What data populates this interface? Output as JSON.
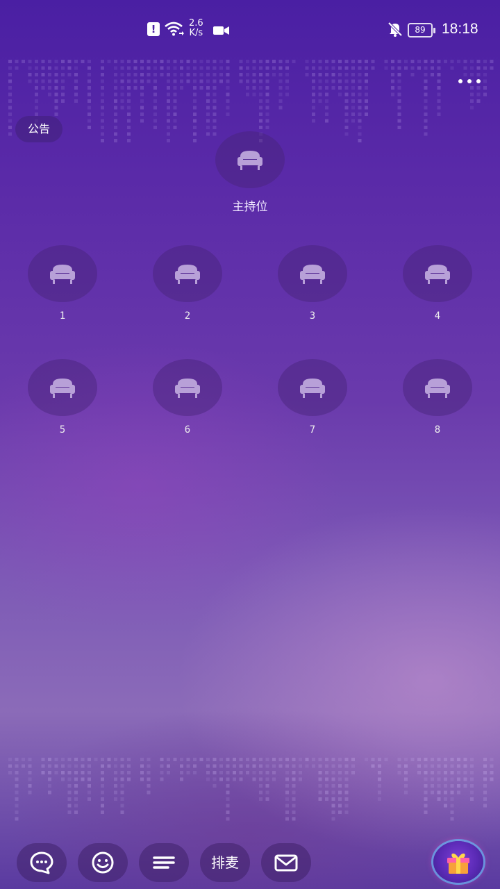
{
  "status_bar": {
    "network_speed_value": "2.6",
    "network_speed_unit": "K/s",
    "battery": "89",
    "time": "18:18",
    "icons": [
      "alert-icon",
      "wifi-icon",
      "video-icon",
      "bell-off-icon",
      "battery-icon"
    ]
  },
  "header": {
    "notice_label": "公告",
    "more_icon": "more-dots-icon"
  },
  "host_seat": {
    "label": "主持位",
    "icon": "sofa-icon"
  },
  "seats": [
    {
      "label": "1",
      "icon": "sofa-icon"
    },
    {
      "label": "2",
      "icon": "sofa-icon"
    },
    {
      "label": "3",
      "icon": "sofa-icon"
    },
    {
      "label": "4",
      "icon": "sofa-icon"
    },
    {
      "label": "5",
      "icon": "sofa-icon"
    },
    {
      "label": "6",
      "icon": "sofa-icon"
    },
    {
      "label": "7",
      "icon": "sofa-icon"
    },
    {
      "label": "8",
      "icon": "sofa-icon"
    }
  ],
  "bottom_bar": {
    "chat_icon": "chat-bubble-icon",
    "emoji_icon": "emoji-icon",
    "menu_icon": "menu-lines-icon",
    "queue_label": "排麦",
    "mail_icon": "mail-icon",
    "gift_icon": "gift-icon"
  },
  "colors": {
    "background_top": "#4a1fa3",
    "background_mid": "#7d5ab6",
    "seat_fill": "#46237880"
  }
}
